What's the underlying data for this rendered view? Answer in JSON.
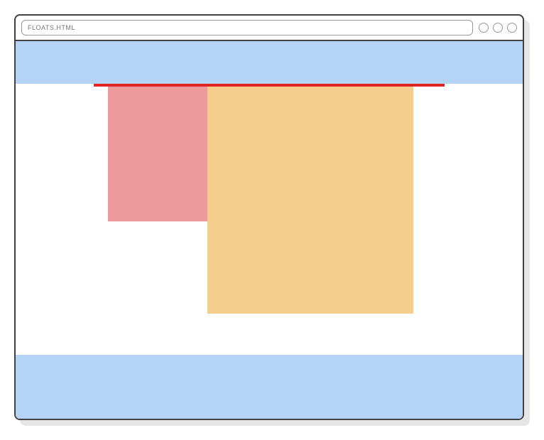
{
  "window": {
    "url": "FLOATS.HTML"
  },
  "colors": {
    "menu_footer": "#b5d4f5",
    "page_border": "#e22427",
    "sidebar": "#ec9a9c",
    "content": "#f5ce8d"
  }
}
